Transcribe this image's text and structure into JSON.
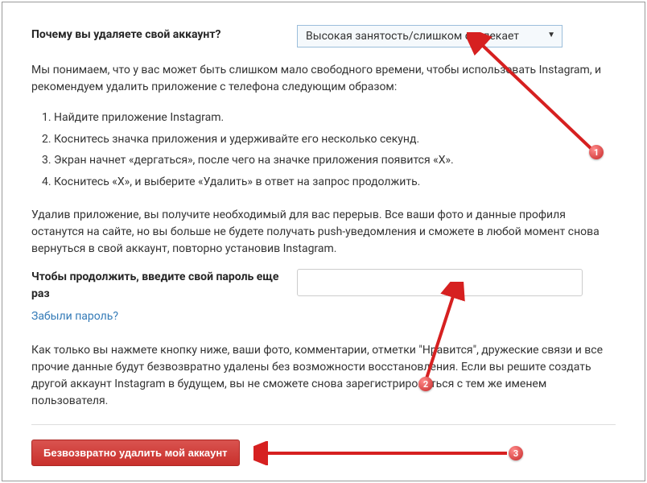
{
  "question": {
    "label": "Почему вы удаляете свой аккаунт?",
    "selected": "Высокая занятость/слишком отвлекает"
  },
  "intro": "Мы понимаем, что у вас может быть слишком мало свободного времени, чтобы использовать Instagram, и рекомендуем удалить приложение с телефона следующим образом:",
  "steps": [
    "Найдите приложение Instagram.",
    "Коснитесь значка приложения и удерживайте его несколько секунд.",
    "Экран начнет «дергаться», после чего на значке приложения появится «X».",
    "Коснитесь «X», и выберите «Удалить» в ответ на запрос продолжить."
  ],
  "after_steps": "Удалив приложение, вы получите необходимый для вас перерыв. Все ваши фото и данные профиля останутся на сайте, но вы больше не будете получать push-уведомления и сможете в любой момент снова вернуться в свой аккаунт, повторно установив Instagram.",
  "password": {
    "label": "Чтобы продолжить, введите свой пароль еще раз",
    "value": ""
  },
  "forgot": "Забыли пароль?",
  "warning": "Как только вы нажмете кнопку ниже, ваши фото, комментарии, отметки \"Нравится\", дружеские связи и все прочие данные будут безвозвратно удалены без возможности восстановления. Если вы решите создать другой аккаунт Instagram в будущем, вы не сможете снова зарегистрироваться с тем же именем пользователя.",
  "delete_button": "Безвозвратно удалить мой аккаунт",
  "annotations": {
    "badge1": "1",
    "badge2": "2",
    "badge3": "3"
  }
}
